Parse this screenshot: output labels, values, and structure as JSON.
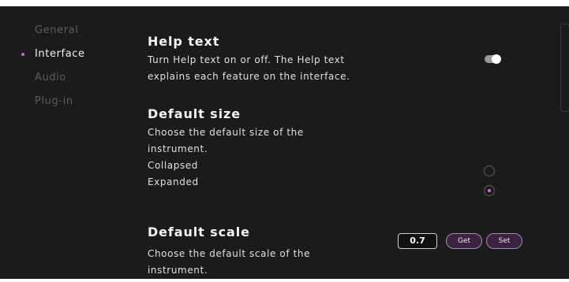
{
  "sidebar": {
    "items": [
      {
        "label": "General",
        "active": false
      },
      {
        "label": "Interface",
        "active": true
      },
      {
        "label": "Audio",
        "active": false
      },
      {
        "label": "Plug-in",
        "active": false
      }
    ]
  },
  "help_text": {
    "title": "Help text",
    "description_line1": "Turn Help text on or off. The Help text",
    "description_line2": "explains each feature on the interface.",
    "toggle_on": true
  },
  "default_size": {
    "title": "Default size",
    "description_line1": "Choose the default size of the",
    "description_line2": "instrument.",
    "options": [
      "Collapsed",
      "Expanded"
    ],
    "selected": "Expanded"
  },
  "default_scale": {
    "title": "Default scale",
    "description_line1": "Choose the default scale of the",
    "description_line2": "instrument.",
    "value": "0.7",
    "get_label": "Get",
    "set_label": "Set"
  },
  "colors": {
    "background": "#1b1b1b",
    "accent": "#c06ad4",
    "button_fill": "#3a2340"
  }
}
